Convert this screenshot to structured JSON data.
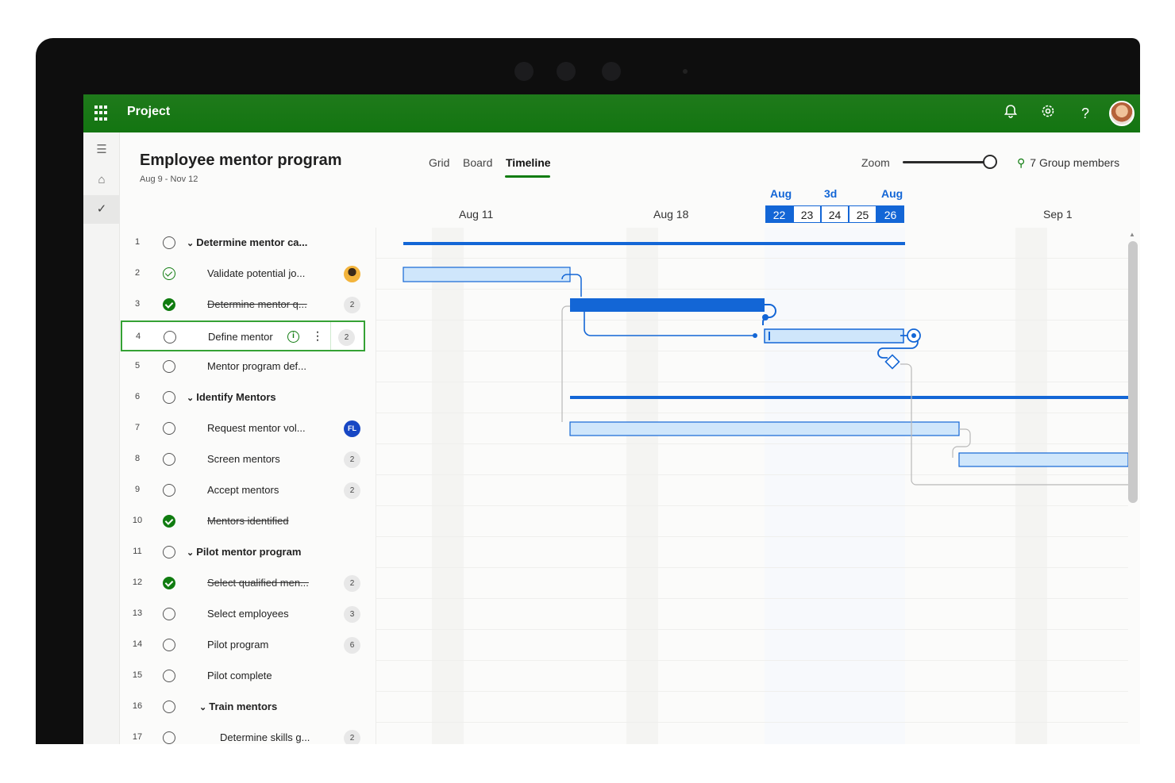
{
  "app": {
    "name": "Project"
  },
  "header": {
    "title": "Employee mentor program",
    "date_range": "Aug 9 - Nov 12",
    "tabs": [
      {
        "label": "Grid",
        "active": false
      },
      {
        "label": "Board",
        "active": false
      },
      {
        "label": "Timeline",
        "active": true
      }
    ],
    "zoom_label": "Zoom",
    "zoom_level": 0.95,
    "members_label": "7 Group members"
  },
  "timeline": {
    "weeks": [
      "Aug 11",
      "Aug 18",
      "Sep 1"
    ],
    "highlight": {
      "start_month": "Aug",
      "duration": "3d",
      "end_month": "Aug"
    },
    "days": [
      "22",
      "23",
      "24",
      "25",
      "26"
    ],
    "selected_days": [
      "22",
      "26"
    ]
  },
  "colors": {
    "suite_green": "#137511",
    "accent_blue": "#1366d6",
    "bar_fill": "#cfe6fb",
    "bar_dark": "#1366d6"
  },
  "tasks": [
    {
      "num": "1",
      "name": "Determine mentor ca...",
      "status": "open",
      "group": true
    },
    {
      "num": "2",
      "name": "Validate potential jo...",
      "status": "check",
      "badge": "face"
    },
    {
      "num": "3",
      "name": "Determine mentor q...",
      "status": "done",
      "badge": "2"
    },
    {
      "num": "4",
      "name": "Define mentor",
      "status": "open",
      "badge": "2",
      "selected": true
    },
    {
      "num": "5",
      "name": "Mentor program def...",
      "status": "open"
    },
    {
      "num": "6",
      "name": "Identify Mentors",
      "status": "open",
      "group": true
    },
    {
      "num": "7",
      "name": "Request mentor vol...",
      "status": "open",
      "badge": "FL",
      "badge_style": "blue"
    },
    {
      "num": "8",
      "name": "Screen mentors",
      "status": "open",
      "badge": "2"
    },
    {
      "num": "9",
      "name": "Accept mentors",
      "status": "open",
      "badge": "2"
    },
    {
      "num": "10",
      "name": "Mentors identified",
      "status": "done"
    },
    {
      "num": "11",
      "name": "Pilot mentor program",
      "status": "open",
      "group": true
    },
    {
      "num": "12",
      "name": "Select qualified men...",
      "status": "done",
      "badge": "2"
    },
    {
      "num": "13",
      "name": "Select employees",
      "status": "open",
      "badge": "3"
    },
    {
      "num": "14",
      "name": "Pilot program",
      "status": "open",
      "badge": "6"
    },
    {
      "num": "15",
      "name": "Pilot complete",
      "status": "open"
    },
    {
      "num": "16",
      "name": "Train mentors",
      "status": "open",
      "group": true,
      "indent": true
    },
    {
      "num": "17",
      "name": "Determine skills g...",
      "status": "open",
      "badge": "2",
      "indent": true
    }
  ]
}
